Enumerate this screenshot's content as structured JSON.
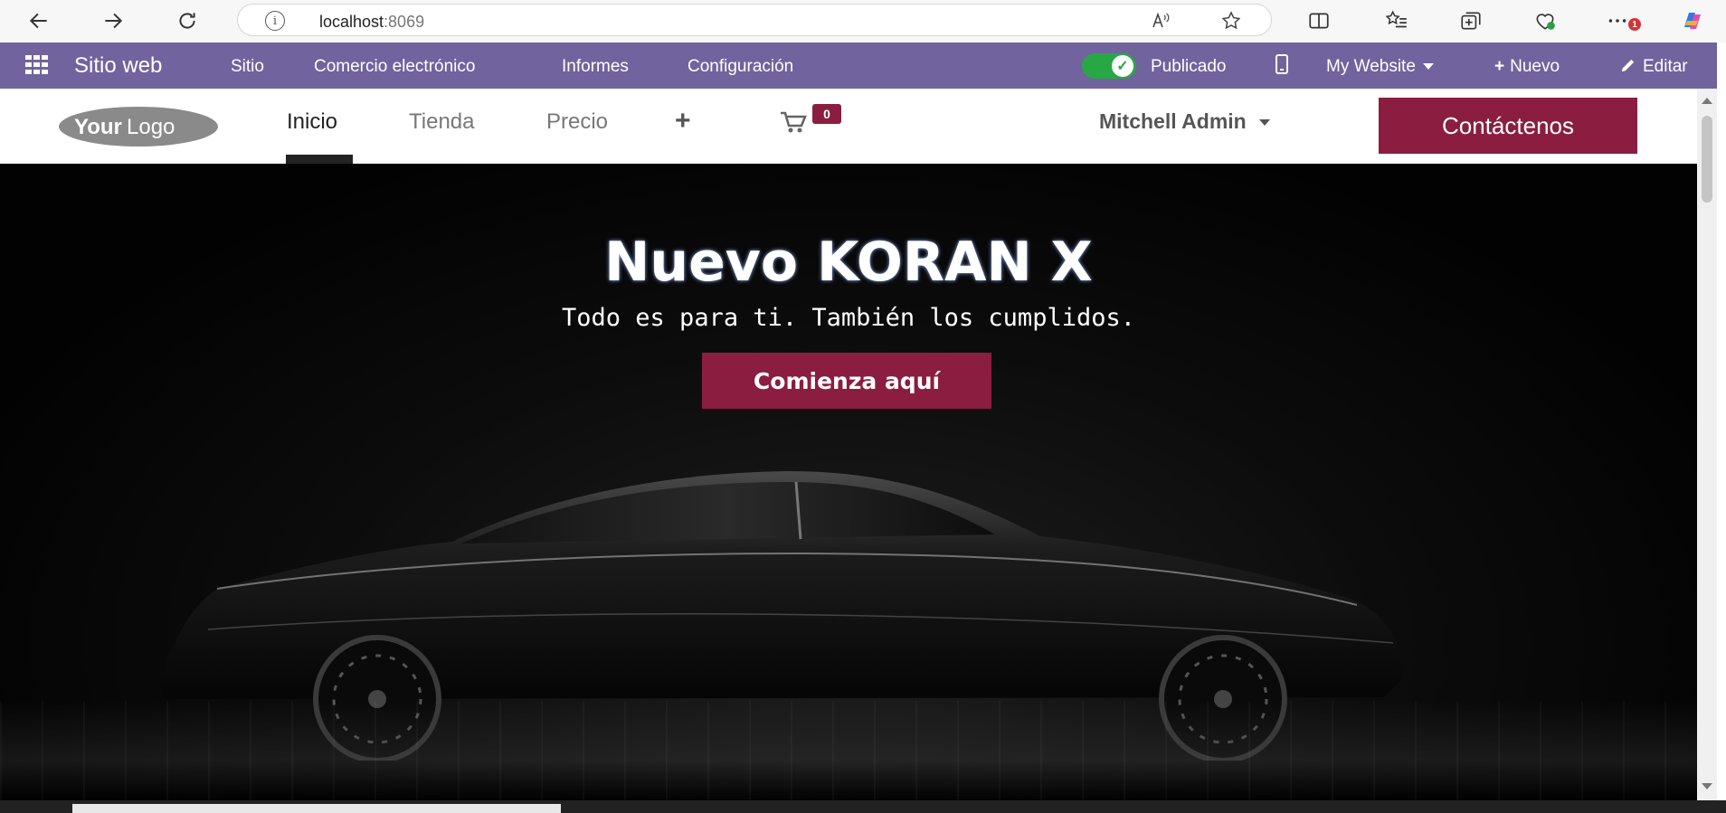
{
  "browser": {
    "url_host": "localhost",
    "url_port": ":8069",
    "info_icon": "i",
    "notification_count": "1"
  },
  "odoo_bar": {
    "brand": "Sitio web",
    "menu": [
      "Sitio",
      "Comercio electrónico",
      "Informes",
      "Configuración"
    ],
    "published_label": "Publicado",
    "website_selector": "My Website",
    "new_label": "Nuevo",
    "edit_label": "Editar",
    "color": "#71639e"
  },
  "site_header": {
    "logo_text_bold": "Your",
    "logo_text_light": "Logo",
    "nav": [
      "Inicio",
      "Tienda",
      "Precio"
    ],
    "active_nav": "Inicio",
    "cart_count": "0",
    "user_name": "Mitchell Admin",
    "contact_label": "Contáctenos",
    "accent_color": "#8b1d41"
  },
  "hero": {
    "title": "Nuevo KORAN X",
    "subtitle": "Todo es para ti. También los cumplidos.",
    "cta_label": "Comienza aquí"
  }
}
